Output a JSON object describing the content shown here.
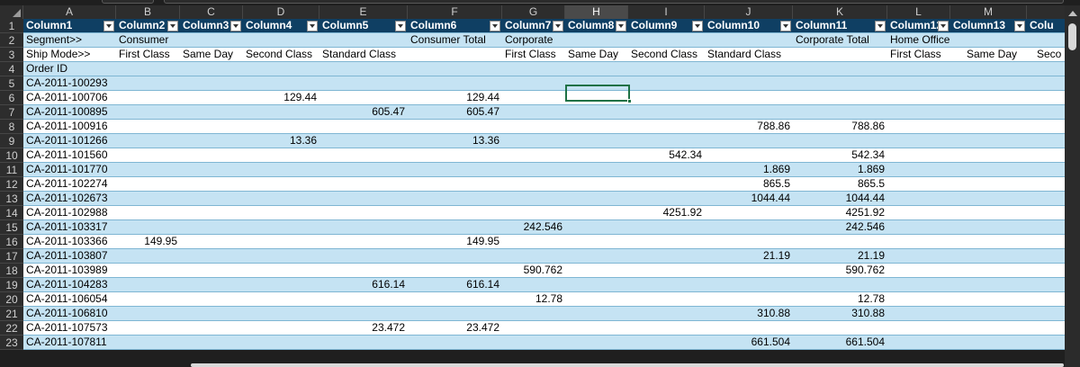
{
  "columns": [
    "A",
    "B",
    "C",
    "D",
    "E",
    "F",
    "G",
    "H",
    "I",
    "J",
    "K",
    "L",
    "M"
  ],
  "row_numbers": [
    "1",
    "2",
    "3",
    "4",
    "5",
    "6",
    "7",
    "8",
    "9",
    "10",
    "11",
    "12",
    "13",
    "14",
    "15",
    "16",
    "17",
    "18",
    "19",
    "20",
    "21",
    "22",
    "23"
  ],
  "header_row": [
    "Column1",
    "Column2",
    "Column3",
    "Column4",
    "Column5",
    "Column6",
    "Column7",
    "Column8",
    "Column9",
    "Column10",
    "Column11",
    "Column12",
    "Column13",
    "Colu"
  ],
  "segment_row": {
    "a": "Segment>>",
    "b": "Consumer",
    "f": "Consumer Total",
    "g": "Corporate",
    "k": "Corporate Total",
    "l": "Home Office"
  },
  "shipmode_row": {
    "a": "Ship Mode>>",
    "b": "First Class",
    "c": "Same Day",
    "d": "Second Class",
    "e": "Standard Class",
    "g": "First Class",
    "h": "Same Day",
    "i": "Second Class",
    "j": "Standard Class",
    "l": "First Class",
    "m": "Same Day",
    "n": "Seco"
  },
  "orderid_label": "Order ID",
  "data_rows": [
    {
      "id": "CA-2011-100293"
    },
    {
      "id": "CA-2011-100706",
      "d": "129.44",
      "f": "129.44"
    },
    {
      "id": "CA-2011-100895",
      "e": "605.47",
      "f": "605.47"
    },
    {
      "id": "CA-2011-100916",
      "j": "788.86",
      "k": "788.86"
    },
    {
      "id": "CA-2011-101266",
      "d": "13.36",
      "f": "13.36"
    },
    {
      "id": "CA-2011-101560",
      "i": "542.34",
      "k": "542.34"
    },
    {
      "id": "CA-2011-101770",
      "j": "1.869",
      "k": "1.869"
    },
    {
      "id": "CA-2011-102274",
      "j": "865.5",
      "k": "865.5"
    },
    {
      "id": "CA-2011-102673",
      "j": "1044.44",
      "k": "1044.44"
    },
    {
      "id": "CA-2011-102988",
      "i": "4251.92",
      "k": "4251.92"
    },
    {
      "id": "CA-2011-103317",
      "g": "242.546",
      "k": "242.546"
    },
    {
      "id": "CA-2011-103366",
      "b": "149.95",
      "f": "149.95"
    },
    {
      "id": "CA-2011-103807",
      "j": "21.19",
      "k": "21.19"
    },
    {
      "id": "CA-2011-103989",
      "g": "590.762",
      "k": "590.762"
    },
    {
      "id": "CA-2011-104283",
      "e": "616.14",
      "f": "616.14"
    },
    {
      "id": "CA-2011-106054",
      "g": "12.78",
      "k": "12.78"
    },
    {
      "id": "CA-2011-106810",
      "j": "310.88",
      "k": "310.88"
    },
    {
      "id": "CA-2011-107573",
      "e": "23.472",
      "f": "23.472"
    },
    {
      "id": "CA-2011-107811",
      "j": "661.504",
      "k": "661.504"
    }
  ],
  "selected_column": "H",
  "colors": {
    "header_fill": "#0f3f63",
    "band_light": "#c5e3f3",
    "band_white": "#ffffff",
    "selection": "#1e7145"
  }
}
